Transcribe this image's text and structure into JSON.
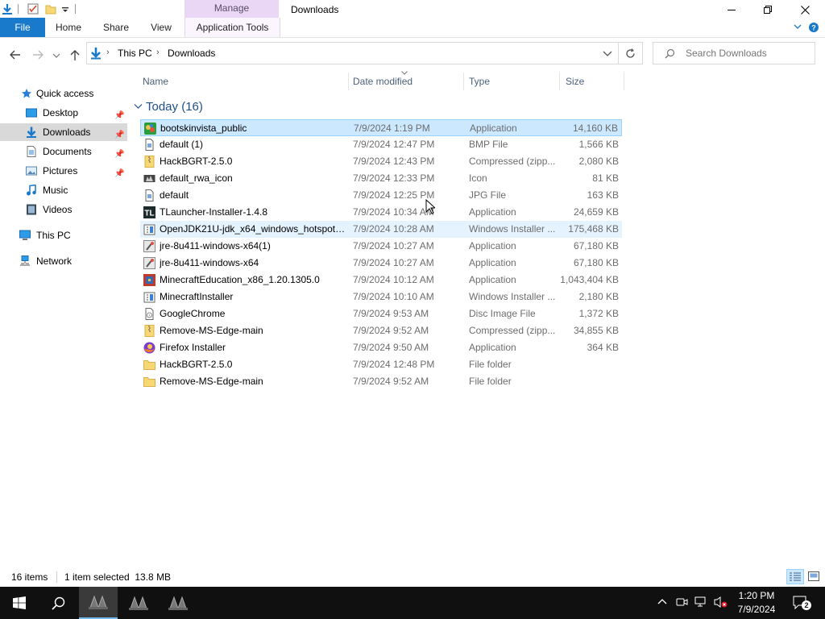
{
  "window": {
    "title": "Downloads",
    "contextual_tab": "Manage"
  },
  "ribbon": {
    "tabs": [
      "File",
      "Home",
      "Share",
      "View",
      "Application Tools"
    ]
  },
  "address": {
    "crumbs": [
      "This PC",
      "Downloads"
    ],
    "search_placeholder": "Search Downloads"
  },
  "nav": {
    "items": [
      {
        "label": "Quick access",
        "icon": "star-icon"
      },
      {
        "label": "Desktop",
        "icon": "desktop-icon"
      },
      {
        "label": "Downloads",
        "icon": "download-icon"
      },
      {
        "label": "Documents",
        "icon": "document-icon"
      },
      {
        "label": "Pictures",
        "icon": "pictures-icon"
      },
      {
        "label": "Music",
        "icon": "music-icon"
      },
      {
        "label": "Videos",
        "icon": "video-icon"
      },
      {
        "label": "This PC",
        "icon": "computer-icon"
      },
      {
        "label": "Network",
        "icon": "network-icon"
      }
    ]
  },
  "columns": {
    "name": "Name",
    "date": "Date modified",
    "type": "Type",
    "size": "Size"
  },
  "group": {
    "label": "Today (16)"
  },
  "files": [
    {
      "name": "bootskinvista_public",
      "date": "7/9/2024 1:19 PM",
      "type": "Application",
      "size": "14,160 KB",
      "icon": "app-colorful-icon"
    },
    {
      "name": "default (1)",
      "date": "7/9/2024 12:47 PM",
      "type": "BMP File",
      "size": "1,566 KB",
      "icon": "image-file-icon"
    },
    {
      "name": "HackBGRT-2.5.0",
      "date": "7/9/2024 12:43 PM",
      "type": "Compressed (zipp...",
      "size": "2,080 KB",
      "icon": "zip-folder-icon"
    },
    {
      "name": "default_rwa_icon",
      "date": "7/9/2024 12:33 PM",
      "type": "Icon",
      "size": "81 KB",
      "icon": "icon-file-icon"
    },
    {
      "name": "default",
      "date": "7/9/2024 12:25 PM",
      "type": "JPG File",
      "size": "163 KB",
      "icon": "image-file-icon"
    },
    {
      "name": "TLauncher-Installer-1.4.8",
      "date": "7/9/2024 10:34 AM",
      "type": "Application",
      "size": "24,659 KB",
      "icon": "tlauncher-icon"
    },
    {
      "name": "OpenJDK21U-jdk_x64_windows_hotspot_...",
      "date": "7/9/2024 10:28 AM",
      "type": "Windows Installer ...",
      "size": "175,468 KB",
      "icon": "installer-icon"
    },
    {
      "name": "jre-8u411-windows-x64(1)",
      "date": "7/9/2024 10:27 AM",
      "type": "Application",
      "size": "67,180 KB",
      "icon": "java-installer-icon"
    },
    {
      "name": "jre-8u411-windows-x64",
      "date": "7/9/2024 10:27 AM",
      "type": "Application",
      "size": "67,180 KB",
      "icon": "java-installer-icon"
    },
    {
      "name": "MinecraftEducation_x86_1.20.1305.0",
      "date": "7/9/2024 10:12 AM",
      "type": "Application",
      "size": "1,043,404 KB",
      "icon": "minecraft-icon"
    },
    {
      "name": "MinecraftInstaller",
      "date": "7/9/2024 10:10 AM",
      "type": "Windows Installer ...",
      "size": "2,180 KB",
      "icon": "installer-icon"
    },
    {
      "name": "GoogleChrome",
      "date": "7/9/2024 9:53 AM",
      "type": "Disc Image File",
      "size": "1,372 KB",
      "icon": "disc-image-icon"
    },
    {
      "name": "Remove-MS-Edge-main",
      "date": "7/9/2024 9:52 AM",
      "type": "Compressed (zipp...",
      "size": "34,855 KB",
      "icon": "zip-folder-icon"
    },
    {
      "name": "Firefox Installer",
      "date": "7/9/2024 9:50 AM",
      "type": "Application",
      "size": "364 KB",
      "icon": "firefox-icon"
    },
    {
      "name": "HackBGRT-2.5.0",
      "date": "7/9/2024 12:48 PM",
      "type": "File folder",
      "size": "",
      "icon": "folder-icon"
    },
    {
      "name": "Remove-MS-Edge-main",
      "date": "7/9/2024 9:52 AM",
      "type": "File folder",
      "size": "",
      "icon": "folder-icon"
    }
  ],
  "status": {
    "count": "16 items",
    "selection": "1 item selected  13.8 MB"
  },
  "taskbar": {
    "time": "1:20 PM",
    "date": "7/9/2024",
    "notifications": "2"
  },
  "colors": {
    "accent": "#1979ca",
    "selection_bg": "#cce8ff",
    "selection_border": "#99d1ff",
    "hover_bg": "#e5f3ff",
    "contextual_tab_bg": "#ead7f5",
    "taskbar_bg": "#101010",
    "folder_yellow": "#f8d775"
  }
}
